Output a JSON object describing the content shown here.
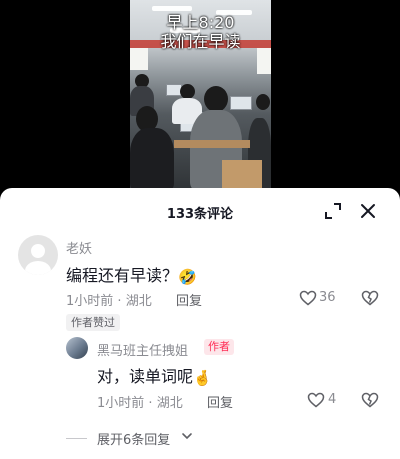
{
  "video": {
    "overlay_line1": "早上8:20",
    "overlay_line2": "我们在早读"
  },
  "panel": {
    "title": "133条评论"
  },
  "comment": {
    "username": "老妖",
    "text": "编程还有早读？",
    "emoji": "🤣",
    "time": "1小时前",
    "location": "湖北",
    "meta_sep": "·",
    "reply_label": "回复",
    "likes": "36",
    "liked_badge": "作者赞过"
  },
  "reply": {
    "username": "黑马班主任拽姐",
    "author_tag": "作者",
    "text": "对，读单词呢",
    "emoji": "🤞",
    "time": "1小时前",
    "location": "湖北",
    "meta_sep": "·",
    "reply_label": "回复",
    "likes": "4"
  },
  "expand": {
    "label": "展开6条回复"
  },
  "colors": {
    "accent": "#fe2c55",
    "text_primary": "#161823",
    "text_secondary": "#8a8b91"
  },
  "icons": [
    "expand-icon",
    "close-icon",
    "heart-icon",
    "broken-heart-icon",
    "chevron-down-icon"
  ]
}
